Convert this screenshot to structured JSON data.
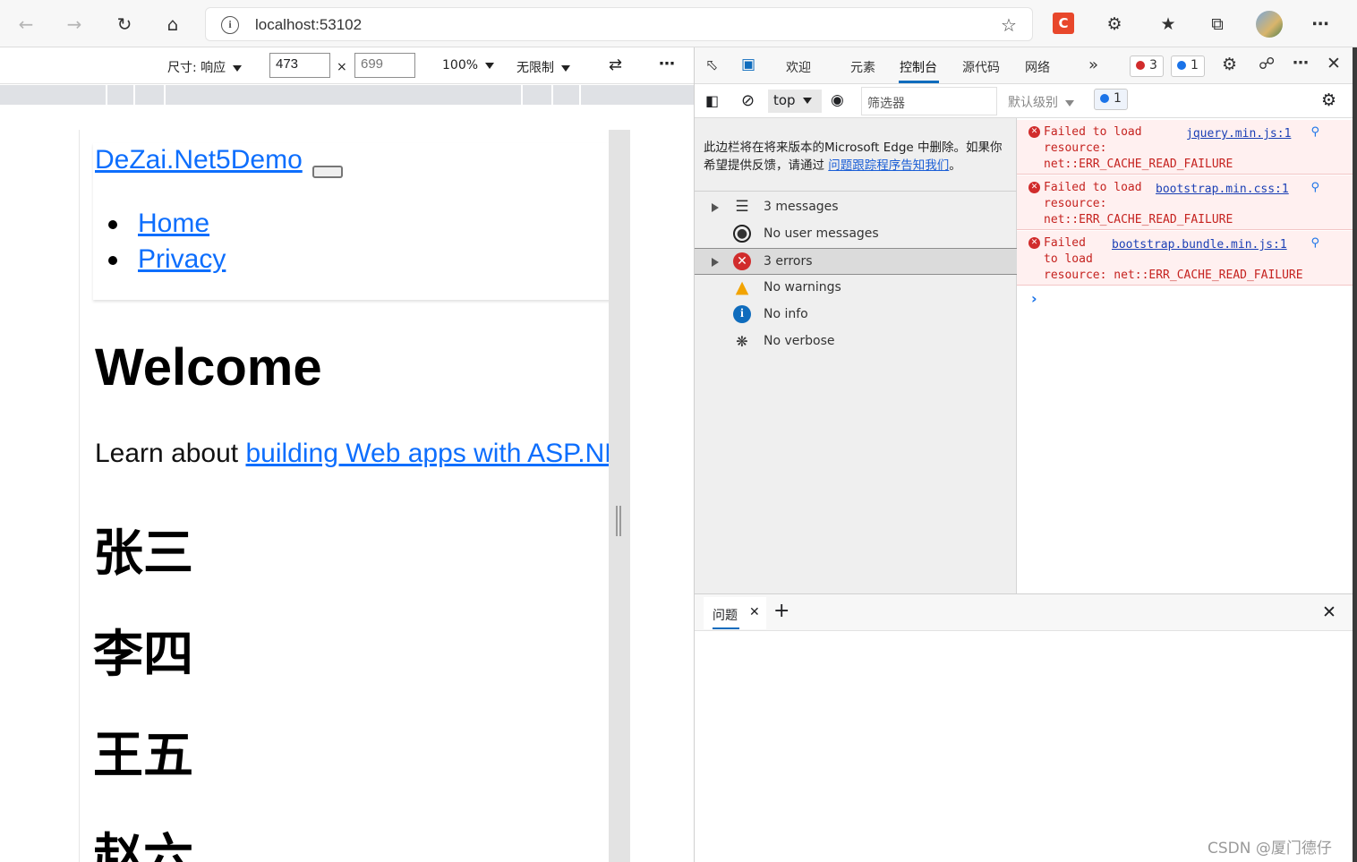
{
  "browser": {
    "url": "localhost:53102",
    "extension_badge": "C"
  },
  "device_toolbar": {
    "dimensions_label": "尺寸: 响应",
    "width": "473",
    "times": "×",
    "height_placeholder": "699",
    "zoom": "100%",
    "throttle": "无限制"
  },
  "page": {
    "brand": "DeZai.Net5Demo",
    "nav": [
      "Home",
      "Privacy"
    ],
    "heading": "Welcome",
    "learn_prefix": "Learn about ",
    "learn_link": "building Web apps with ASP.NET Core",
    "names": [
      "张三",
      "李四",
      "王五",
      "赵六"
    ]
  },
  "devtools": {
    "tabs": [
      "欢迎",
      "元素",
      "控制台",
      "源代码",
      "网络"
    ],
    "active_tab": "控制台",
    "error_count": "3",
    "info_count": "1",
    "context": "top",
    "filter_placeholder": "筛选器",
    "level": "默认级别",
    "filter_badge": "1",
    "notice_text": "此边栏将在将来版本的Microsoft Edge 中删除。如果你希望提供反馈，请通过 ",
    "notice_link": "问题跟踪程序告知我们",
    "notice_end": "。",
    "sidebar": [
      {
        "label": "3 messages",
        "icon": "list-icon"
      },
      {
        "label": "No user messages",
        "icon": "user-icon"
      },
      {
        "label": "3 errors",
        "icon": "error-icon"
      },
      {
        "label": "No warnings",
        "icon": "warning-icon"
      },
      {
        "label": "No info",
        "icon": "info-icon"
      },
      {
        "label": "No verbose",
        "icon": "bug-icon"
      }
    ],
    "messages": [
      {
        "text": "Failed to load\nresource:\nnet::ERR_CACHE_READ_FAILURE",
        "source": "jquery.min.js:1"
      },
      {
        "text": "Failed to load\nresource:\nnet::ERR_CACHE_READ_FAILURE",
        "source": "bootstrap.min.css:1"
      },
      {
        "text": "Failed\nto load\nresource: net::ERR_CACHE_READ_FAILURE",
        "source": "bootstrap.bundle.min.js:1"
      }
    ],
    "drawer_tab": "问题"
  },
  "watermark": "CSDN @厦门德仔",
  "colors": {
    "link": "#0d6efd",
    "error": "#c5221f",
    "accent": "#0f6cbd"
  }
}
